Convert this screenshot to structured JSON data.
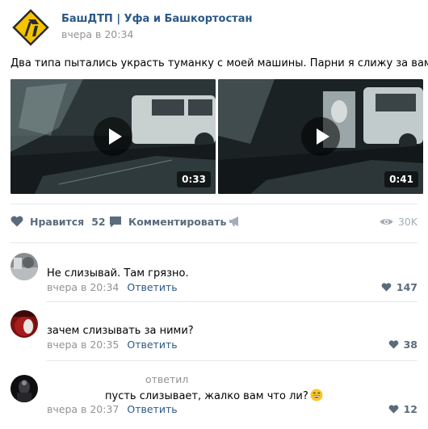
{
  "post": {
    "group_name": "БашДТП | Уфа и Башкортостан",
    "time": "вчера в 20:34",
    "text": "Два типа пытались украсть туманку с моей машины. Парни я слижу за вами."
  },
  "videos": [
    {
      "duration": "0:33"
    },
    {
      "duration": "0:41"
    }
  ],
  "actions": {
    "like_label": "Нравится",
    "like_count": "52",
    "comment_label": "Комментировать",
    "views": "30K"
  },
  "comments": [
    {
      "text": "Не слизывай. Там грязно.",
      "time": "вчера в 20:34",
      "reply": "Ответить",
      "likes": "147"
    },
    {
      "text": "зачем слизывать за ними?",
      "time": "вчера в 20:35",
      "reply": "Ответить",
      "likes": "38"
    },
    {
      "answered": "ответил",
      "text": "пусть слизывает, жалко вам что ли?",
      "time": "вчера в 20:37",
      "reply": "Ответить",
      "likes": "12"
    }
  ],
  "colors": {
    "link": "#2a5885",
    "muted": "#939393",
    "action": "#5b6b7e",
    "logo_yellow": "#f5c400"
  },
  "icons": [
    "logo-icon",
    "play-icon",
    "heart-icon",
    "comment-icon",
    "megaphone-icon",
    "eye-icon",
    "grinning-emoji-icon"
  ]
}
